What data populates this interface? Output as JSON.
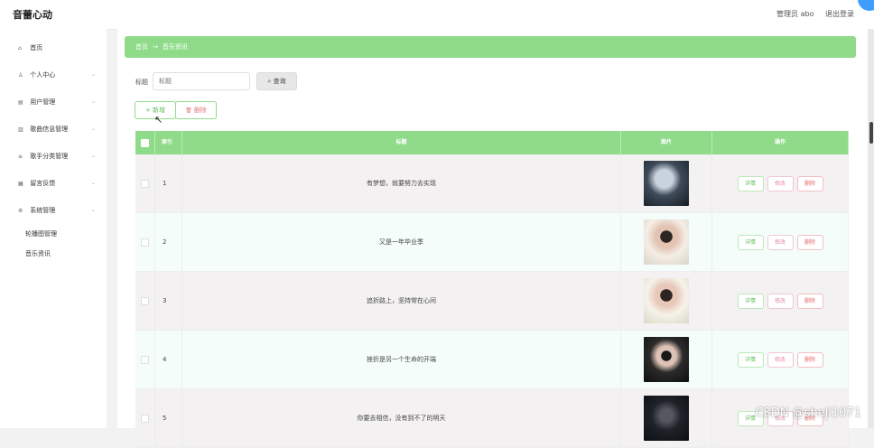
{
  "app": {
    "title": "音蕾心动"
  },
  "topbar": {
    "user": "管理员 abo",
    "logout": "退出登录"
  },
  "sidebar": {
    "items": [
      {
        "label": "首页",
        "icon": "home-icon",
        "icon_glyph": "⌂",
        "chevron": ""
      },
      {
        "label": "个人中心",
        "icon": "user-icon",
        "icon_glyph": "♙",
        "chevron": "⌄"
      },
      {
        "label": "用户管理",
        "icon": "users-icon",
        "icon_glyph": "▤",
        "chevron": "⌄"
      },
      {
        "label": "歌曲信息管理",
        "icon": "music-icon",
        "icon_glyph": "▥",
        "chevron": "⌄"
      },
      {
        "label": "歌手分类管理",
        "icon": "category-icon",
        "icon_glyph": "≡",
        "chevron": "⌄"
      },
      {
        "label": "留言反馈",
        "icon": "message-icon",
        "icon_glyph": "▦",
        "chevron": "⌄"
      },
      {
        "label": "系统管理",
        "icon": "settings-icon",
        "icon_glyph": "⚙",
        "chevron": "⌄"
      }
    ],
    "subitems": [
      {
        "label": "轮播图管理"
      },
      {
        "label": "音乐资讯"
      }
    ]
  },
  "breadcrumb": {
    "home": "首页",
    "separator": "→",
    "current": "音乐资讯"
  },
  "search": {
    "label": "标题",
    "placeholder": "标题",
    "button": "查询",
    "button_icon": "⌕"
  },
  "actions": {
    "add": "+ 新增",
    "delete": "删除",
    "delete_icon": "🗑"
  },
  "table": {
    "headers": {
      "index": "索引",
      "title": "标题",
      "image": "图片",
      "ops": "操作"
    },
    "rows": [
      {
        "index": "1",
        "title": "有梦想，就要努力去实现",
        "thumb": "thumb-1"
      },
      {
        "index": "2",
        "title": "又是一年毕业季",
        "thumb": "thumb-2"
      },
      {
        "index": "3",
        "title": "追折路上，坚持常在心间",
        "thumb": "thumb-3"
      },
      {
        "index": "4",
        "title": "挫折是另一个生命的开端",
        "thumb": "thumb-4"
      },
      {
        "index": "5",
        "title": "你要去相信，没有到不了的明天",
        "thumb": "thumb-5"
      }
    ],
    "ops_labels": {
      "detail": "详情",
      "edit": "修改",
      "delete": "删除"
    }
  },
  "watermark": "CSDN @sheji1071",
  "colors": {
    "accent": "#8fdb8a",
    "page_bg": "#f2f2f2",
    "link_blue": "#409eff"
  }
}
